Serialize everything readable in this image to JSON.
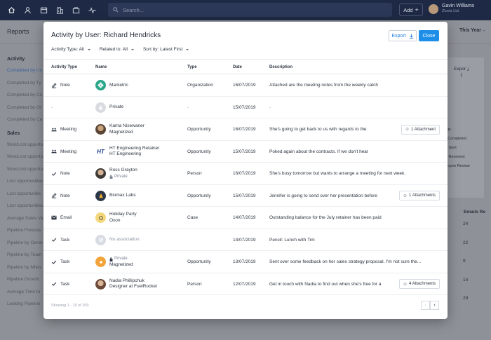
{
  "topbar": {
    "search_placeholder": "Search...",
    "add_label": "Add",
    "user_name": "Gavin Williams",
    "user_company": "Zluvia Ltd.",
    "nav_icons": [
      "home-icon",
      "person-icon",
      "calendar-icon",
      "building-icon",
      "briefcase-icon",
      "activity-icon"
    ]
  },
  "background": {
    "page_title": "Reports",
    "period": "This Year",
    "sidebar": {
      "activity_heading": "Activity",
      "activity_items": [
        "Completed by Us",
        "Completed by Ty",
        "Completed by Co",
        "Completed by Or",
        "Completed by Ca"
      ],
      "sales_heading": "Sales",
      "sales_items": [
        "Won/Lost opportu",
        "Won/Lost opportu",
        "Won/Lost opportu",
        "Lost opportunities",
        "Lost opportunitie",
        "Lost opportunities",
        "Average Sales Va",
        "Pipeline Forecas",
        "Pipeline by Owne",
        "Pipeline by Team",
        "Pipeline by Miles",
        "Pipeline Growth",
        "Average Time to",
        "Leaking Pipeline"
      ]
    },
    "export_label": "Expor",
    "export_value": "1",
    "right_labels": [
      "ngs",
      "s Completed",
      "ls Sent",
      "ls Received",
      "ployee Review"
    ],
    "table_header": "Emails Re",
    "table_values": [
      "24",
      "22",
      "9",
      "14",
      "29"
    ]
  },
  "modal": {
    "title": "Activity by User: Richard Hendricks",
    "export_label": "Export",
    "close_label": "Close",
    "filters": [
      {
        "label": "Activity Type: All"
      },
      {
        "label": "Related to: All"
      },
      {
        "label": "Sort by: Latest First"
      }
    ],
    "columns": [
      "Activity Type",
      "Name",
      "Type",
      "Date",
      "Description"
    ],
    "rows": [
      {
        "type": "Note",
        "type_icon": "note-icon",
        "avatar": "marketric-logo",
        "name": "Marketric",
        "name_sub": "",
        "private": false,
        "rel": "Organization",
        "date": "16/07/2019",
        "desc": "Attached are the meeting notes from the weekly catch",
        "attachment": ""
      },
      {
        "type": "-",
        "type_icon": "",
        "avatar": "lock-avatar",
        "name": "Private",
        "name_sub": "",
        "private": false,
        "rel": "-",
        "date": "15/07/2019",
        "desc": "-",
        "attachment": ""
      },
      {
        "type": "Meeting",
        "type_icon": "meeting-icon",
        "avatar": "karna-photo",
        "name": "Karna Nisewaner",
        "name_sub": "Magnetized",
        "private": false,
        "rel": "Opportunity",
        "date": "16/07/2019",
        "desc": "She's going to get back to us with regards to the",
        "attachment": "1 Attachment"
      },
      {
        "type": "Meeting",
        "type_icon": "meeting-icon",
        "avatar": "ht-logo",
        "name": "HT Engineering Retainer",
        "name_sub": "HT Engineering",
        "private": false,
        "rel": "Opportunity",
        "date": "15/07/2019",
        "desc": "Poked again about the contracts. If we don't hear",
        "attachment": ""
      },
      {
        "type": "Note",
        "type_icon": "check-icon",
        "avatar": "ross-photo",
        "name": "Ross Grayton",
        "name_sub": "Private",
        "private": true,
        "rel": "Person",
        "date": "16/07/2019",
        "desc": "She's busy tomorrow but wants to arrange a meeting for next week.",
        "attachment": ""
      },
      {
        "type": "Note",
        "type_icon": "note-icon",
        "avatar": "biomax-logo",
        "name": "Biomax Labs",
        "name_sub": "",
        "private": false,
        "rel": "Opportunity",
        "date": "15/07/2019",
        "desc": "Jennifer is going to send over her presentation before",
        "attachment": "1 Attachments"
      },
      {
        "type": "Email",
        "type_icon": "email-icon",
        "avatar": "holiday-logo",
        "name": "Holiday Party",
        "name_sub": "Oxon",
        "private": false,
        "rel": "Case",
        "date": "14/07/2019",
        "desc": "Outstanding balance for the July retainer has been paid",
        "attachment": ""
      },
      {
        "type": "Task",
        "type_icon": "check-icon",
        "avatar": "no-assoc-avatar",
        "name": "No association",
        "name_sub": "",
        "private": false,
        "rel": "",
        "date": "14/07/2019",
        "desc": "Pencil: Lunch with Tim",
        "attachment": ""
      },
      {
        "type": "Task",
        "type_icon": "check-icon",
        "avatar": "orange-avatar",
        "name": "Private",
        "name_sub": "Magnetized",
        "private": true,
        "rel": "Opportunity",
        "date": "13/07/2019",
        "desc": "Sent over some feedback on her sales strategy proposal. I'm not sure the...",
        "attachment": ""
      },
      {
        "type": "Task",
        "type_icon": "check-icon",
        "avatar": "nadia-photo",
        "name": "Nadia Phillipchuk",
        "name_sub": "Designer at FuelRocket",
        "private": false,
        "rel": "Person",
        "date": "12/07/2019",
        "desc": "Get in touch with Nadia to find out when she's free for a",
        "attachment": "4 Attachments"
      }
    ],
    "footer": "Showing 1 - 10 of 200",
    "pager_prev": "‹",
    "pager_next": "›"
  },
  "colors": {
    "nav_bg": "#1e2a45",
    "primary": "#1e8fe8",
    "link": "#1e7ce0"
  }
}
